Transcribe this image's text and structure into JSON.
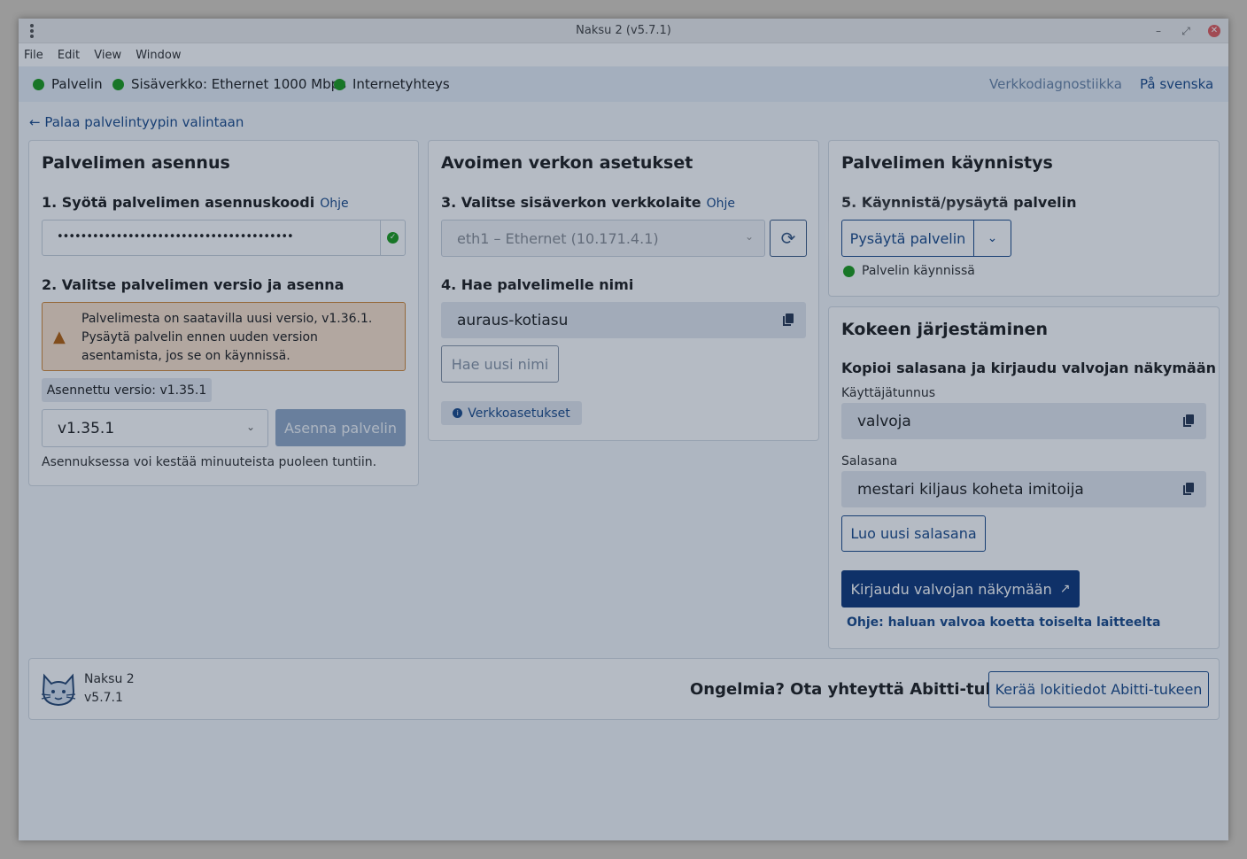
{
  "window": {
    "title": "Naksu 2 (v5.7.1)"
  },
  "menu": [
    "File",
    "Edit",
    "View",
    "Window"
  ],
  "status": {
    "server": "Palvelin",
    "lan": "Sisäverkko: Ethernet 1000 Mbps",
    "internet": "Internetyhteys",
    "diagnostics_link": "Verkkodiagnostiikka",
    "language_link": "På svenska"
  },
  "back_link": "Palaa palvelintyypin valintaan",
  "install": {
    "title": "Palvelimen asennus",
    "step1": "1. Syötä palvelimen asennuskoodi",
    "help": "Ohje",
    "code_value": "••••••••••••••••••••••••••••••••••••••••",
    "step2": "2. Valitse palvelimen versio ja asenna",
    "warning": "Palvelimesta on saatavilla uusi versio, v1.36.1. Pysäytä palvelin ennen uuden version asentamista, jos se on käynnissä.",
    "installed_version": "Asennettu versio: v1.35.1",
    "version_select": "v1.35.1",
    "install_button": "Asenna palvelin",
    "note": "Asennuksessa voi kestää minuuteista puoleen tuntiin."
  },
  "network": {
    "title": "Avoimen verkon asetukset",
    "step3": "3. Valitse sisäverkon verkkolaite",
    "help": "Ohje",
    "device_select": "eth1 – Ethernet (10.171.4.1)",
    "step4": "4. Hae palvelimelle nimi",
    "server_name": "auraus-kotiasu",
    "new_name_button": "Hae uusi nimi",
    "settings_badge": "Verkkoasetukset"
  },
  "startup": {
    "title": "Palvelimen käynnistys",
    "step5": "5. Käynnistä/pysäytä palvelin",
    "stop_button": "Pysäytä palvelin",
    "running_status": "Palvelin käynnissä"
  },
  "exam": {
    "title": "Kokeen järjestäminen",
    "subtitle": "Kopioi salasana ja kirjaudu valvojan näkymään",
    "username_label": "Käyttäjätunnus",
    "username": "valvoja",
    "password_label": "Salasana",
    "password": "mestari kiljaus koheta imitoija",
    "new_password_button": "Luo uusi salasana",
    "login_button": "Kirjaudu valvojan näkymään",
    "help_link": "Ohje: haluan valvoa koetta toiselta laitteelta"
  },
  "footer": {
    "app_name": "Naksu 2",
    "app_version": "v5.7.1",
    "problem_text": "Ongelmia? Ota yhteyttä Abitti-tukeen",
    "logs_button": "Kerää lokitiedot Abitti-tukeen"
  },
  "colors": {
    "accent": "#123a7c",
    "ok": "#1f9d1f",
    "warning_bg": "#fbe3cc",
    "warning_border": "#d28a3c"
  }
}
